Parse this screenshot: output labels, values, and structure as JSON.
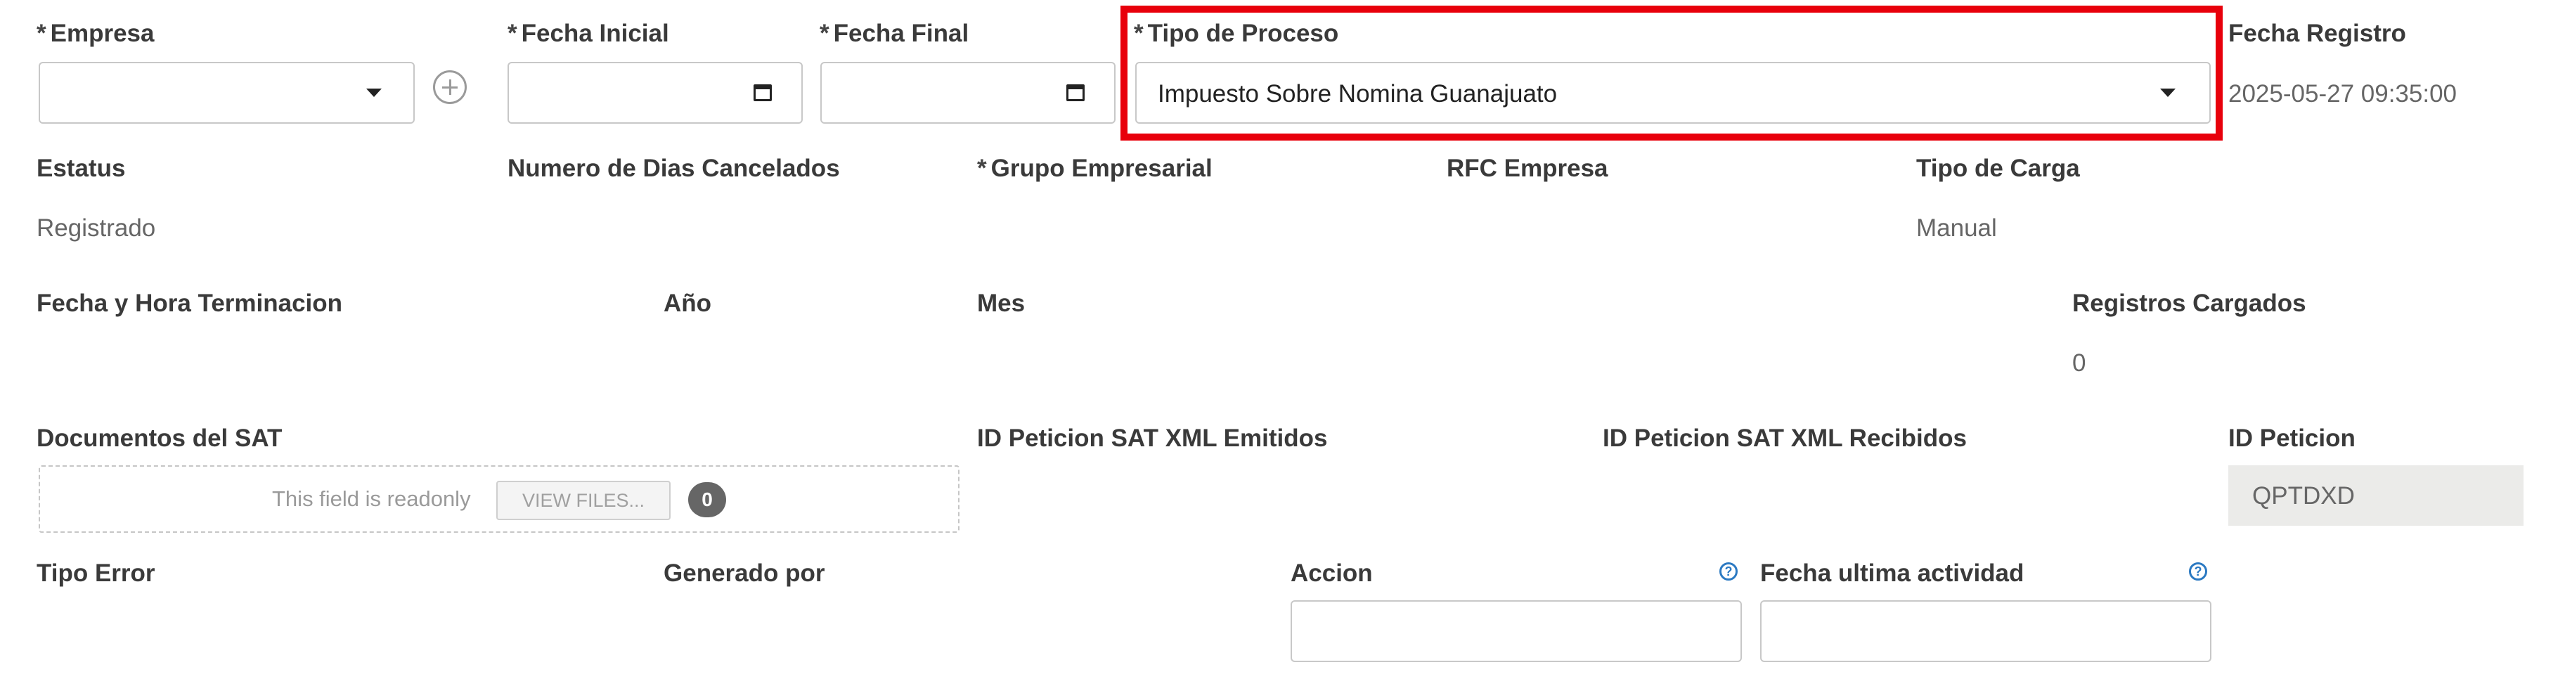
{
  "fields": {
    "empresa": {
      "label": "Empresa",
      "value": ""
    },
    "fecha_inicial": {
      "label": "Fecha Inicial",
      "value": ""
    },
    "fecha_final": {
      "label": "Fecha Final",
      "value": ""
    },
    "tipo_proceso": {
      "label": "Tipo de Proceso",
      "value": "Impuesto Sobre Nomina Guanajuato"
    },
    "fecha_registro": {
      "label": "Fecha Registro",
      "value": "2025-05-27 09:35:00"
    },
    "estatus": {
      "label": "Estatus",
      "value": "Registrado"
    },
    "numero_dias_cancelados": {
      "label": "Numero de Dias Cancelados",
      "value": ""
    },
    "grupo_empresarial": {
      "label": "Grupo Empresarial",
      "value": ""
    },
    "rfc_empresa": {
      "label": "RFC Empresa",
      "value": ""
    },
    "tipo_carga": {
      "label": "Tipo de Carga",
      "value": "Manual"
    },
    "fecha_hora_terminacion": {
      "label": "Fecha y Hora Terminacion",
      "value": ""
    },
    "anio": {
      "label": "Año",
      "value": ""
    },
    "mes": {
      "label": "Mes",
      "value": ""
    },
    "registros_cargados": {
      "label": "Registros Cargados",
      "value": "0"
    },
    "documentos_sat": {
      "label": "Documentos del SAT",
      "readonly_text": "This field is readonly",
      "view_files_label": "VIEW FILES...",
      "file_count": "0"
    },
    "id_peticion_emitidos": {
      "label": "ID Peticion SAT XML Emitidos",
      "value": ""
    },
    "id_peticion_recibidos": {
      "label": "ID Peticion SAT XML Recibidos",
      "value": ""
    },
    "id_peticion": {
      "label": "ID Peticion",
      "value": "QPTDXD"
    },
    "tipo_error": {
      "label": "Tipo Error",
      "value": ""
    },
    "generado_por": {
      "label": "Generado por",
      "value": ""
    },
    "accion": {
      "label": "Accion",
      "value": ""
    },
    "fecha_ultima_actividad": {
      "label": "Fecha ultima actividad",
      "value": ""
    }
  },
  "required_marker": "*",
  "help_icon_glyph": "?",
  "colors": {
    "highlight": "#e8000b",
    "help": "#2b79c2",
    "readonly_bg": "#ebebe9"
  }
}
